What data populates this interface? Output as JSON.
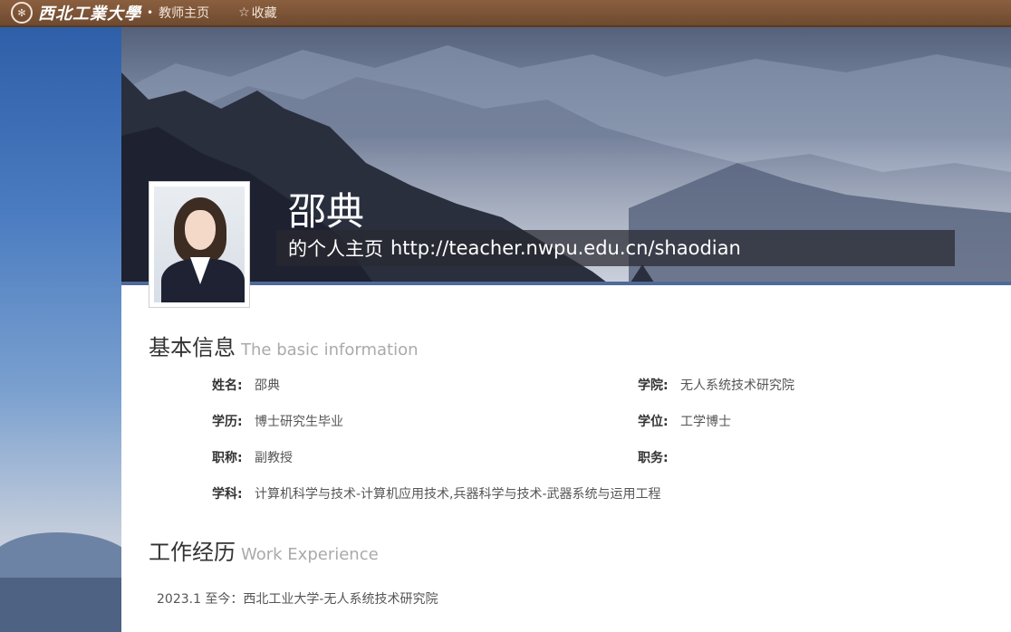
{
  "header": {
    "logo_seal": "西工大",
    "logo_text": "西北工業大學",
    "separator": "•",
    "home_label": "教师主页",
    "favorite_icon": "☆",
    "favorite_label": "收藏"
  },
  "profile": {
    "name": "邵典",
    "subtitle_prefix": "的个人主页",
    "url": "http://teacher.nwpu.edu.cn/shaodian"
  },
  "basic_info": {
    "title_zh": "基本信息",
    "title_en": "The basic information",
    "name_label": "姓名:",
    "name_value": "邵典",
    "college_label": "学院:",
    "college_value": "无人系统技术研究院",
    "education_label": "学历:",
    "education_value": "博士研究生毕业",
    "degree_label": "学位:",
    "degree_value": "工学博士",
    "title_label": "职称:",
    "title_value": "副教授",
    "position_label": "职务:",
    "position_value": "",
    "discipline_label": "学科:",
    "discipline_value": "计算机科学与技术-计算机应用技术,兵器科学与技术-武器系统与运用工程"
  },
  "work_experience": {
    "title_zh": "工作经历",
    "title_en": "Work Experience",
    "items": [
      "2023.1 至今：西北工业大学-无人系统技术研究院"
    ]
  }
}
